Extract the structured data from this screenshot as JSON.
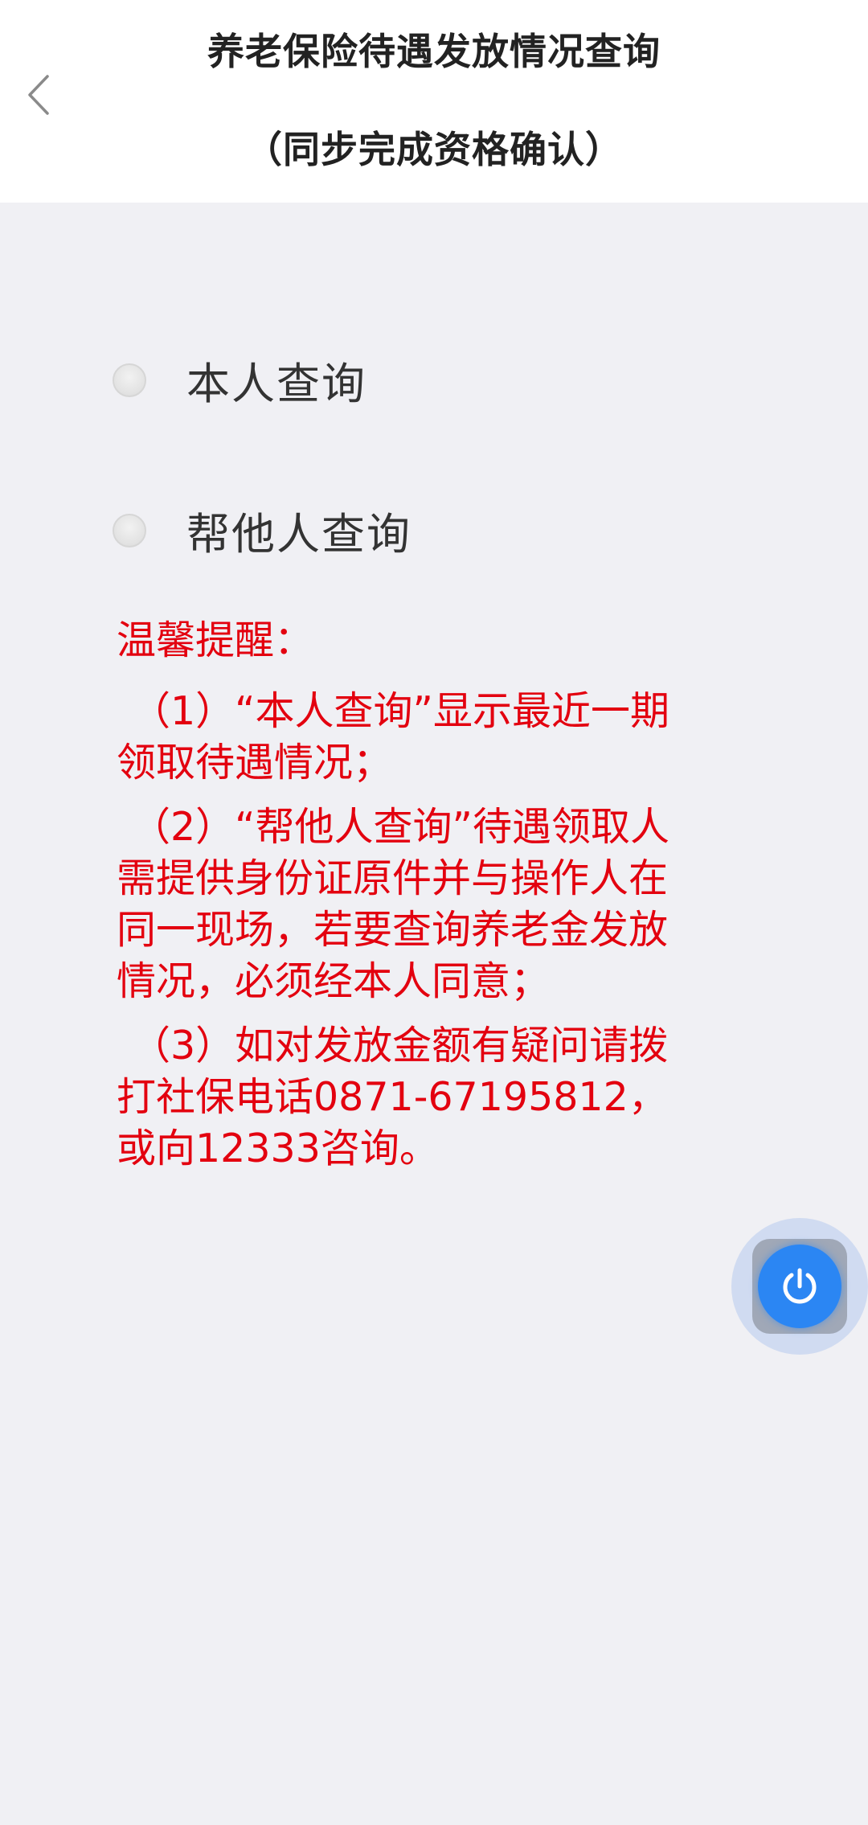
{
  "header": {
    "title_line1": "养老保险待遇发放情况查询",
    "title_line2": "（同步完成资格确认）",
    "back_icon": "chevron-left-icon"
  },
  "options": [
    {
      "label": "本人查询",
      "selected": false
    },
    {
      "label": "帮他人查询",
      "selected": false
    }
  ],
  "tips": {
    "title": "温馨提醒：",
    "items": [
      "（1）“本人查询”显示最近一期领取待遇情况；",
      "（2）“帮他人查询”待遇领取人需提供身份证原件并与操作人在同一现场，若要查询养老金发放情况，必须经本人同意；",
      "（3）如对发放金额有疑问请拨打社保电话0871-67195812，或向12333咨询。"
    ]
  },
  "floating_button": {
    "icon": "power-icon"
  },
  "colors": {
    "background": "#f0f0f4",
    "header_background": "#ffffff",
    "tip_text": "#e3000f",
    "accent": "#2b86f3"
  }
}
